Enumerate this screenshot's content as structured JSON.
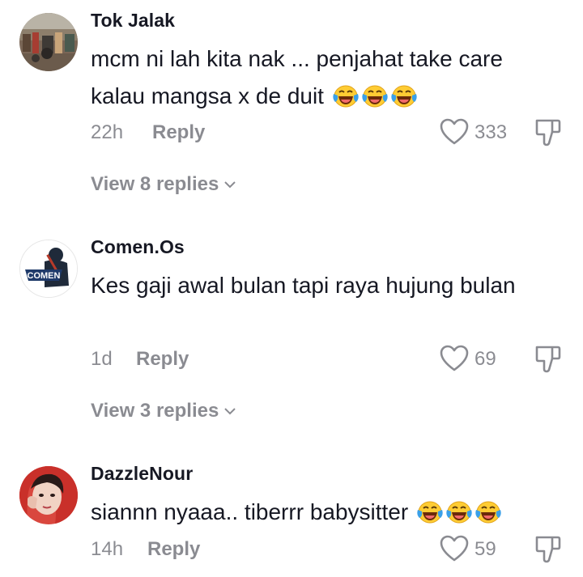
{
  "comments": [
    {
      "username": "Tok Jalak",
      "text": "mcm ni lah kita nak ... penjahat take care kalau mangsa x de duit",
      "emojis": [
        "laughing-tears-emoji",
        "laughing-tears-emoji",
        "laughing-tears-emoji"
      ],
      "time": "22h",
      "reply_label": "Reply",
      "likes": "333",
      "view_replies": "View 8 replies",
      "avatar_icon": "street-scene-avatar"
    },
    {
      "username": "Comen.Os",
      "text": "Kes gaji awal bulan tapi raya hujung bulan",
      "emojis": [],
      "time": "1d",
      "reply_label": "Reply",
      "likes": "69",
      "view_replies": "View 3 replies",
      "avatar_icon": "comen-logo-avatar",
      "avatar_logo_text": "COMEN"
    },
    {
      "username": "DazzleNour",
      "text": "siannn nyaaa.. tiberrr babysitter",
      "emojis": [
        "laughing-tears-emoji",
        "laughing-tears-emoji",
        "laughing-tears-emoji"
      ],
      "time": "14h",
      "reply_label": "Reply",
      "likes": "59",
      "avatar_icon": "portrait-avatar"
    }
  ],
  "colors": {
    "text": "#161823",
    "muted": "#8a8b91",
    "emoji_face": "#ffcc33",
    "emoji_tear": "#3aa0e8"
  }
}
